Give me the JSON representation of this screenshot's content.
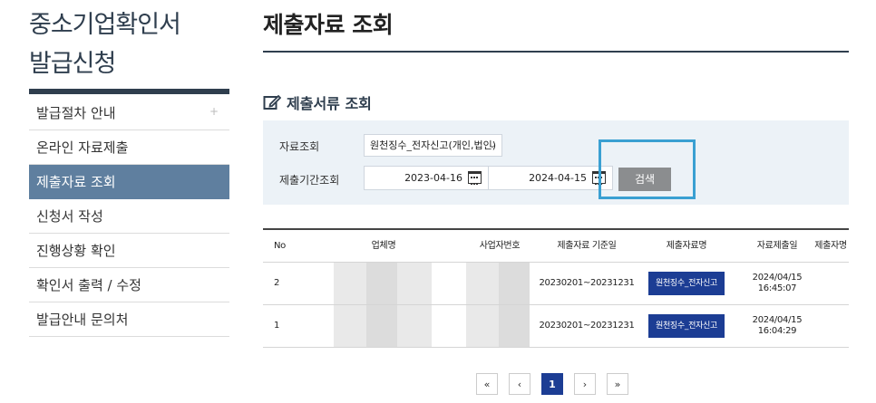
{
  "sidebar": {
    "title_line1": "중소기업확인서",
    "title_line2": "발급신청",
    "items": [
      {
        "label": "발급절차 안내",
        "expand": "+"
      },
      {
        "label": "온라인 자료제출"
      },
      {
        "label": "제출자료 조회",
        "active": true
      },
      {
        "label": "신청서 작성"
      },
      {
        "label": "진행상황 확인"
      },
      {
        "label": "확인서 출력 / 수정"
      },
      {
        "label": "발급안내 문의처"
      }
    ]
  },
  "main": {
    "title": "제출자료 조회",
    "section_title": "제출서류 조회",
    "search": {
      "type_label": "자료조회",
      "type_value": "원천징수_전자신고(개인,법인)",
      "period_label": "제출기간조회",
      "date_from": "2023-04-16",
      "date_to": "2024-04-15",
      "search_button": "검색"
    },
    "table": {
      "headers": [
        "No",
        "업체명",
        "사업자번호",
        "제출자료 기준일",
        "제출자료명",
        "자료제출일",
        "제출자명"
      ],
      "rows": [
        {
          "no": "2",
          "base_period": "20230201~20231231",
          "doc": "원천징수_전자신고",
          "date_line1": "2024/04/15",
          "date_line2": "16:45:07"
        },
        {
          "no": "1",
          "base_period": "20230201~20231231",
          "doc": "원천징수_전자신고",
          "date_line1": "2024/04/15",
          "date_line2": "16:04:29"
        }
      ]
    },
    "pagination": {
      "first": "«",
      "prev": "‹",
      "current": "1",
      "next": "›",
      "last": "»"
    }
  },
  "colors": {
    "accent": "#5f7f9f",
    "navy": "#2f3e4e",
    "doc_button": "#1c3d94",
    "highlight": "#3aa0d2"
  }
}
